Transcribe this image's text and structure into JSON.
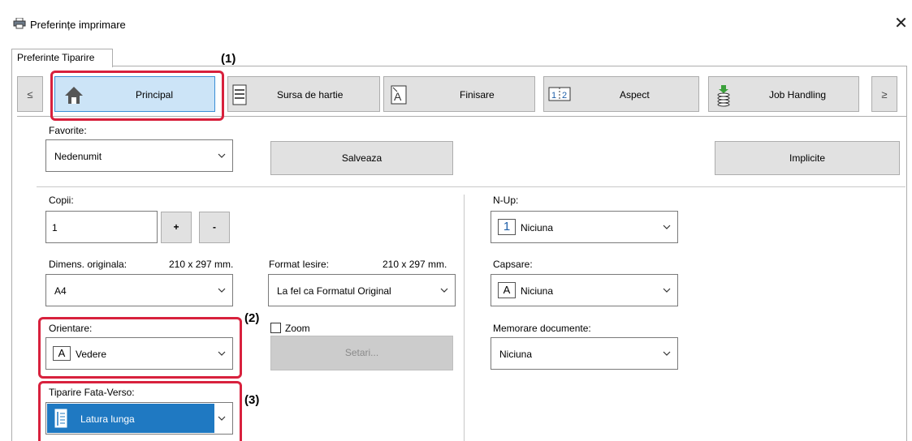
{
  "window": {
    "title": "Preferințe imprimare",
    "close_symbol": "✕"
  },
  "tabs": [
    {
      "label": "Preferinte Tiparire"
    }
  ],
  "nav": {
    "prev_symbol": "≤",
    "next_symbol": "≥",
    "items": [
      {
        "label": "Principal",
        "icon": "home-icon",
        "selected": true
      },
      {
        "label": "Sursa de hartie",
        "icon": "paper-tray-icon"
      },
      {
        "label": "Finisare",
        "icon": "finishing-icon"
      },
      {
        "label": "Aspect",
        "icon": "layout-icon",
        "icon_text": "1|2"
      },
      {
        "label": "Job Handling",
        "icon": "job-handling-icon"
      }
    ]
  },
  "favorites": {
    "label": "Favorite:",
    "value": "Nedenumit",
    "save_button": "Salveaza",
    "defaults_button": "Implicite"
  },
  "copies": {
    "label": "Copii:",
    "value": "1",
    "plus": "+",
    "minus": "-"
  },
  "original_size": {
    "label": "Dimens. originala:",
    "dims": "210 x 297 mm.",
    "value": "A4"
  },
  "output_format": {
    "label": "Format Iesire:",
    "dims": "210 x 297 mm.",
    "value": "La fel ca Formatul Original"
  },
  "orientation": {
    "label": "Orientare:",
    "value": "Vedere",
    "icon_text": "A"
  },
  "zoom": {
    "label": "Zoom",
    "checked": false,
    "settings_button": "Setari..."
  },
  "duplex": {
    "label": "Tiparire Fata-Verso:",
    "value": "Latura lunga"
  },
  "nup": {
    "label": "N-Up:",
    "value": "Niciuna",
    "icon_text": "1"
  },
  "staple": {
    "label": "Capsare:",
    "value": "Niciuna",
    "icon_text": "A"
  },
  "doc_storage": {
    "label": "Memorare documente:",
    "value": "Niciuna"
  },
  "callouts": [
    {
      "text": "(1)"
    },
    {
      "text": "(2)"
    },
    {
      "text": "(3)"
    }
  ],
  "colors": {
    "highlight": "#d8213d",
    "selected_bg": "#1f79c2",
    "selected_nav": "#cce4f7"
  }
}
